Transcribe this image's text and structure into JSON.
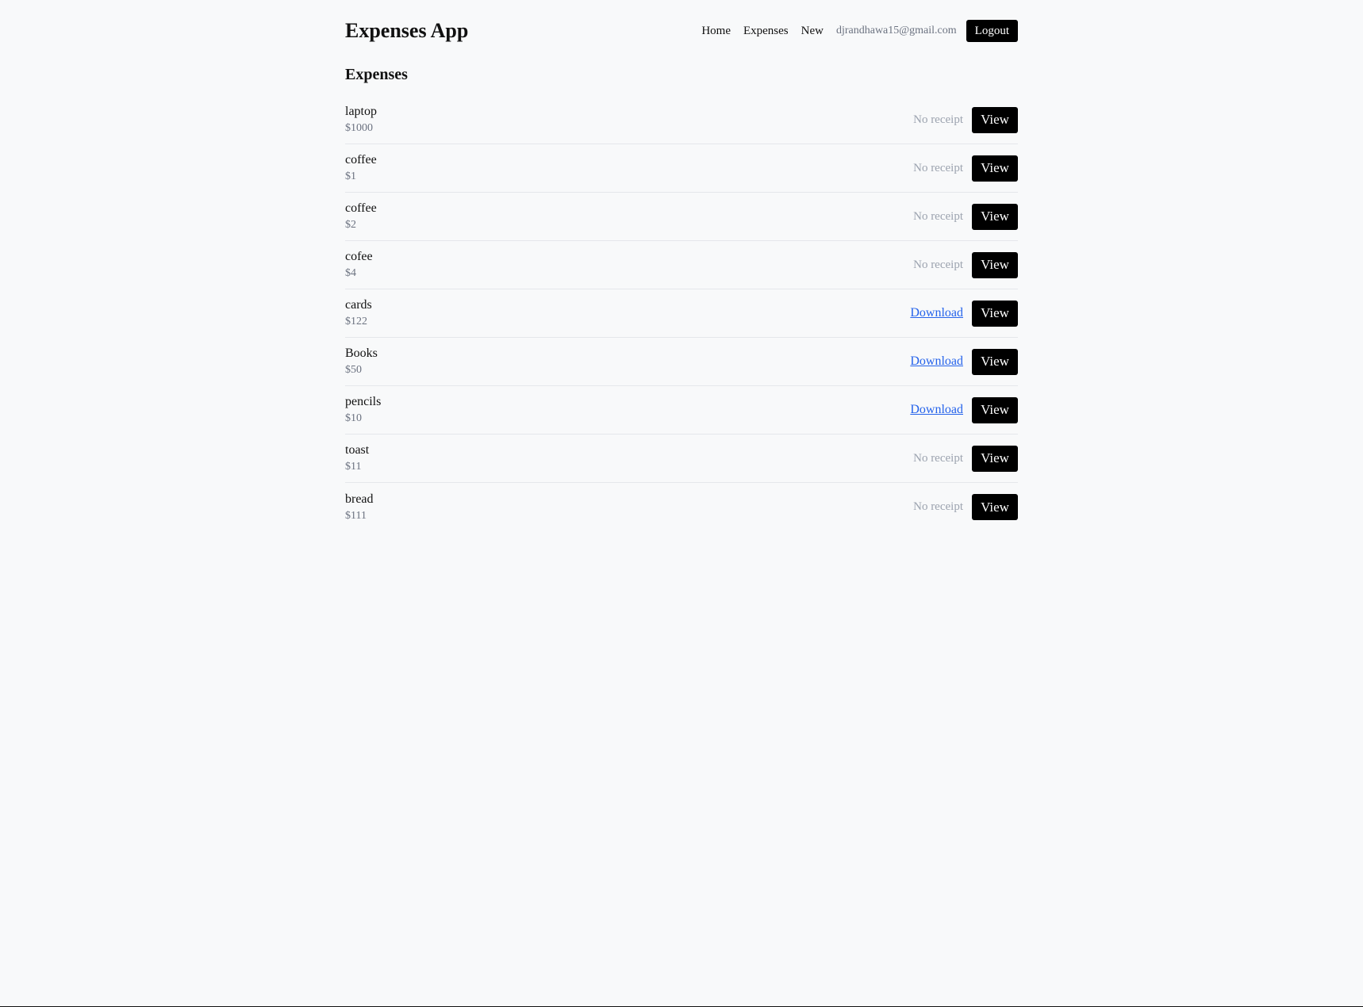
{
  "header": {
    "title": "Expenses App",
    "nav": {
      "home": "Home",
      "expenses": "Expenses",
      "new": "New"
    },
    "user_email": "djrandhawa15@gmail.com",
    "logout_label": "Logout"
  },
  "main": {
    "heading": "Expenses",
    "view_label": "View",
    "expenses": [
      {
        "name": "laptop",
        "amount": "$1000",
        "receipt": "No receipt"
      },
      {
        "name": "coffee",
        "amount": "$1",
        "receipt": "No receipt"
      },
      {
        "name": "coffee",
        "amount": "$2",
        "receipt": "No receipt"
      },
      {
        "name": "cofee",
        "amount": "$4",
        "receipt": "No receipt"
      },
      {
        "name": "cards",
        "amount": "$122",
        "receipt": "Download"
      },
      {
        "name": "Books",
        "amount": "$50",
        "receipt": "Download"
      },
      {
        "name": "pencils",
        "amount": "$10",
        "receipt": "Download"
      },
      {
        "name": "toast",
        "amount": "$11",
        "receipt": "No receipt"
      },
      {
        "name": "bread",
        "amount": "$111",
        "receipt": "No receipt"
      }
    ]
  },
  "colors": {
    "background": "#f8f9fa",
    "button": "#000000",
    "link": "#2563eb",
    "muted": "#6b7280"
  }
}
